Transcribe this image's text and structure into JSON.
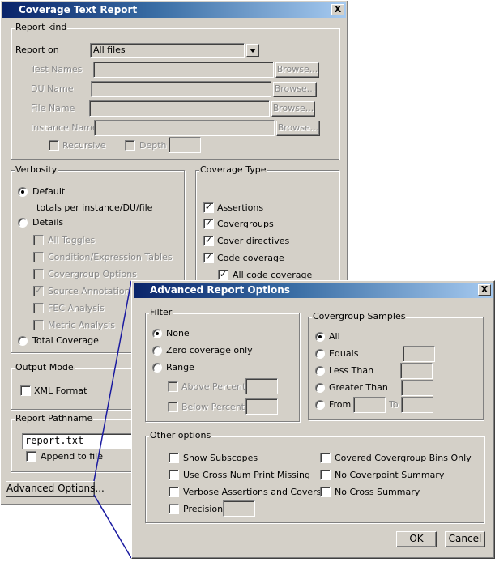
{
  "main_dialog": {
    "title": "Coverage Text Report",
    "close_label": "X",
    "report_kind": {
      "label": "Report kind",
      "report_on_label": "Report on",
      "report_on_value": "All files",
      "test_names_label": "Test Names",
      "du_name_label": "DU Name",
      "file_name_label": "File Name",
      "instance_name_label": "Instance Name",
      "browse_label": "Browse...",
      "recursive_label": "Recursive",
      "depth_label": "Depth"
    },
    "verbosity": {
      "label": "Verbosity",
      "default_label": "Default",
      "default_desc": "totals per instance/DU/file",
      "details_label": "Details",
      "detail_options": [
        {
          "label": "All Toggles",
          "checked": false
        },
        {
          "label": "Condition/Expression Tables",
          "checked": false
        },
        {
          "label": "Covergroup Options",
          "checked": false
        },
        {
          "label": "Source Annotation",
          "checked": true
        },
        {
          "label": "FEC Analysis",
          "checked": false
        },
        {
          "label": "Metric Analysis",
          "checked": false
        }
      ],
      "total_label": "Total Coverage",
      "selected": "Default"
    },
    "coverage_type": {
      "label": "Coverage Type",
      "items": [
        {
          "label": "Assertions",
          "checked": true
        },
        {
          "label": "Covergroups",
          "checked": true
        },
        {
          "label": "Cover directives",
          "checked": true
        },
        {
          "label": "Code coverage",
          "checked": true
        },
        {
          "label": "All code coverage",
          "checked": true
        }
      ]
    },
    "output_mode": {
      "label": "Output Mode",
      "xml_label": "XML Format",
      "xml_checked": false
    },
    "report_pathname": {
      "label": "Report Pathname",
      "value": "report.txt",
      "append_label": "Append to file",
      "append_checked": false
    },
    "advanced_button": "Advanced Options..."
  },
  "advanced_dialog": {
    "title": "Advanced Report Options",
    "close_label": "X",
    "filter": {
      "label": "Filter",
      "none_label": "None",
      "zero_label": "Zero coverage only",
      "range_label": "Range",
      "above_label": "Above Percent",
      "below_label": "Below Percent",
      "selected": "None"
    },
    "covergroup_samples": {
      "label": "Covergroup Samples",
      "all_label": "All",
      "equals_label": "Equals",
      "less_label": "Less Than",
      "greater_label": "Greater Than",
      "from_label": "From",
      "to_label": "To",
      "selected": "All"
    },
    "other_options": {
      "label": "Other options",
      "left": [
        {
          "label": "Show Subscopes",
          "checked": false
        },
        {
          "label": "Use Cross Num Print Missing",
          "checked": false
        },
        {
          "label": "Verbose Assertions and Covers",
          "checked": false
        },
        {
          "label": "Precision",
          "checked": false
        }
      ],
      "right": [
        {
          "label": "Covered Covergroup Bins Only",
          "checked": false
        },
        {
          "label": "No Coverpoint Summary",
          "checked": false
        },
        {
          "label": "No Cross Summary",
          "checked": false
        }
      ]
    },
    "ok_label": "OK",
    "cancel_label": "Cancel"
  },
  "colors": {
    "dialog_bg": "#d4d0c8",
    "title_start": "#0a246a",
    "title_end": "#a6caf0",
    "callout_line": "#1a1aa0"
  }
}
